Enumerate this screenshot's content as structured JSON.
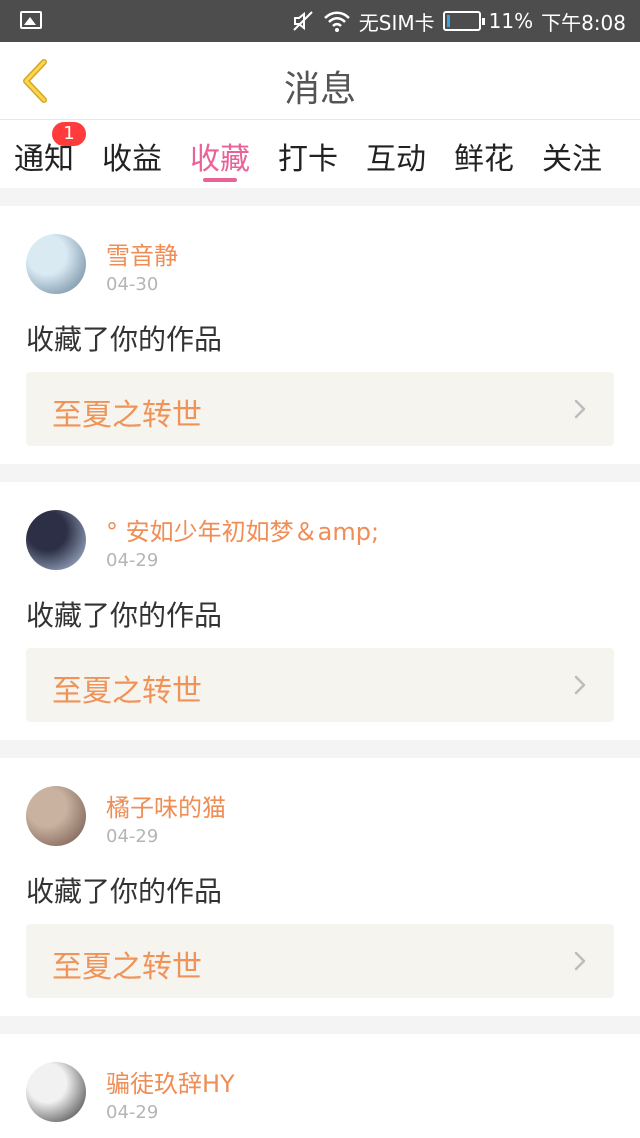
{
  "status_bar": {
    "sim_text": "无SIM卡",
    "battery_percent": "11%",
    "time": "下午8:08",
    "battery_level": 0.11
  },
  "header": {
    "title": "消息"
  },
  "tabs": [
    {
      "label": "通知",
      "badge": "1"
    },
    {
      "label": "收益"
    },
    {
      "label": "收藏",
      "active": true
    },
    {
      "label": "打卡"
    },
    {
      "label": "互动"
    },
    {
      "label": "鲜花"
    },
    {
      "label": "关注"
    }
  ],
  "items": [
    {
      "username": "雪音静",
      "date": "04-30",
      "message": "收藏了你的作品",
      "work_title": "至夏之转世",
      "avatar_colors": [
        "#d9eaf3",
        "#5d7a92"
      ]
    },
    {
      "username": "° 安如少年初如梦＆amp;",
      "date": "04-29",
      "message": "收藏了你的作品",
      "work_title": "至夏之转世",
      "avatar_colors": [
        "#2c2f45",
        "#b7c9e3"
      ]
    },
    {
      "username": "橘子味的猫",
      "date": "04-29",
      "message": "收藏了你的作品",
      "work_title": "至夏之转世",
      "avatar_colors": [
        "#c9b2a0",
        "#6b4f45"
      ]
    },
    {
      "username": "骗徒玖辞HY",
      "date": "04-29",
      "message": "",
      "work_title": "",
      "avatar_colors": [
        "#f1f1f1",
        "#2a2a2a"
      ]
    }
  ],
  "colors": {
    "accent": "#e96399",
    "username": "#ef8d55",
    "work_title": "#f09358",
    "badge": "#ff3b3b"
  }
}
